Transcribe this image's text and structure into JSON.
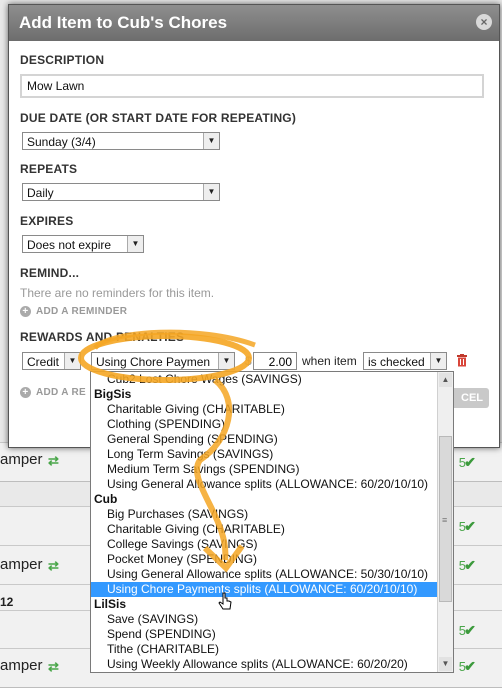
{
  "background": {
    "rows": [
      {
        "text": "amper",
        "num": "5"
      },
      {
        "text": "",
        "num": "5"
      },
      {
        "text": "amper",
        "num": "5"
      },
      {
        "text": "12",
        "num": "5"
      },
      {
        "text": "",
        "num": "5"
      },
      {
        "text": "amper",
        "num": "5"
      }
    ],
    "left_fragments": [
      "2",
      "a",
      "1",
      "a",
      "1"
    ]
  },
  "modal": {
    "title": "Add Item to Cub's Chores",
    "close_icon": "close-icon",
    "description_label": "DESCRIPTION",
    "description_value": "Mow Lawn",
    "due_date_label": "DUE DATE (OR START DATE FOR REPEATING)",
    "due_date_value": "Sunday (3/4)",
    "repeats_label": "REPEATS",
    "repeats_value": "Daily",
    "expires_label": "EXPIRES",
    "expires_value": "Does not expire",
    "remind_label": "REMIND...",
    "remind_note": "There are no reminders for this item.",
    "add_reminder": "ADD A REMINDER",
    "rewards_label": "REWARDS AND PENALTIES",
    "reward_type": "Credit",
    "reward_account": "Using Chore Paymen",
    "dollar_sign": "$",
    "amount": "2.00",
    "when_item": "when item",
    "condition": "is checked",
    "add_reward": "ADD A RE",
    "cancel_label": "CEL"
  },
  "dropdown": {
    "items": [
      {
        "type": "item",
        "label": "Cub2 Lost Chore Wages (SAVINGS)"
      },
      {
        "type": "group",
        "label": "BigSis"
      },
      {
        "type": "item",
        "label": "Charitable Giving (CHARITABLE)"
      },
      {
        "type": "item",
        "label": "Clothing (SPENDING)"
      },
      {
        "type": "item",
        "label": "General Spending (SPENDING)"
      },
      {
        "type": "item",
        "label": "Long Term Savings (SAVINGS)"
      },
      {
        "type": "item",
        "label": "Medium Term Savings (SPENDING)"
      },
      {
        "type": "item",
        "label": "Using General Allowance splits (ALLOWANCE: 60/20/10/10)"
      },
      {
        "type": "group",
        "label": "Cub"
      },
      {
        "type": "item",
        "label": "Big Purchases (SAVINGS)"
      },
      {
        "type": "item",
        "label": "Charitable Giving (CHARITABLE)"
      },
      {
        "type": "item",
        "label": "College Savings (SAVINGS)"
      },
      {
        "type": "item",
        "label": "Pocket Money (SPENDING)"
      },
      {
        "type": "item",
        "label": "Using General Allowance splits (ALLOWANCE: 50/30/10/10)"
      },
      {
        "type": "item",
        "label": "Using Chore Payments splits (ALLOWANCE: 60/20/10/10)",
        "selected": true
      },
      {
        "type": "group",
        "label": "LilSis"
      },
      {
        "type": "item",
        "label": "Save (SAVINGS)"
      },
      {
        "type": "item",
        "label": "Spend (SPENDING)"
      },
      {
        "type": "item",
        "label": "Tithe (CHARITABLE)"
      },
      {
        "type": "item",
        "label": "Using Weekly Allowance splits (ALLOWANCE: 60/20/20)"
      }
    ]
  },
  "colors": {
    "highlight": "#f5a623",
    "selected": "#3399ff",
    "header": "#7a7a7a"
  }
}
